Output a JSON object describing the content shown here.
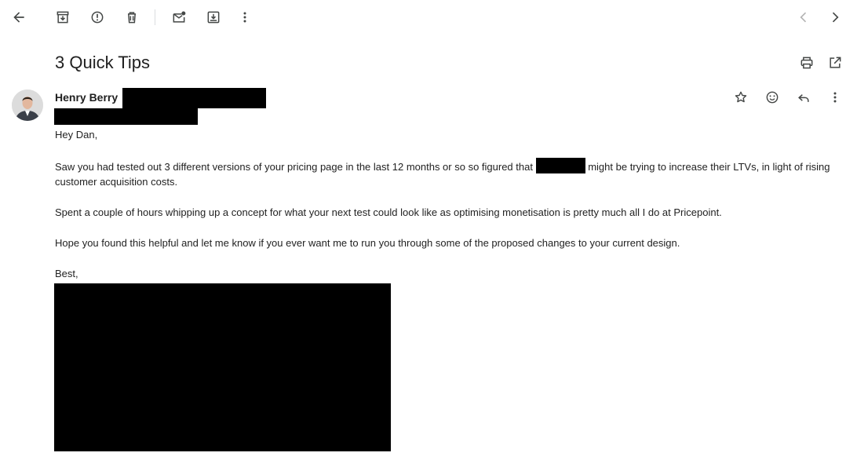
{
  "toolbar": {
    "icons": [
      "back-arrow-icon",
      "archive-icon",
      "report-spam-icon",
      "delete-icon",
      "mark-unread-icon",
      "move-to-icon",
      "more-vert-icon",
      "chevron-left-icon",
      "chevron-right-icon"
    ]
  },
  "email": {
    "subject": "3 Quick Tips",
    "sender_name": "Henry Berry",
    "greeting": "Hey Dan,",
    "para1_before": "Saw you had tested out 3 different versions of your pricing page in the last 12 months or so so figured that",
    "para1_after": "might be trying to increase their LTVs, in light of rising customer acquisition costs.",
    "para2": "Spent a couple of hours whipping up a concept for what your next test could look like as optimising monetisation is pretty much all I do at Pricepoint.",
    "para3": "Hope you found this helpful and let me know if you ever want me to run you through some of the proposed changes to your current design.",
    "signoff": "Best,"
  },
  "colors": {
    "icon": "#444746",
    "icon_disabled": "#b4b4b4",
    "text": "#202124",
    "redaction": "#000000"
  }
}
